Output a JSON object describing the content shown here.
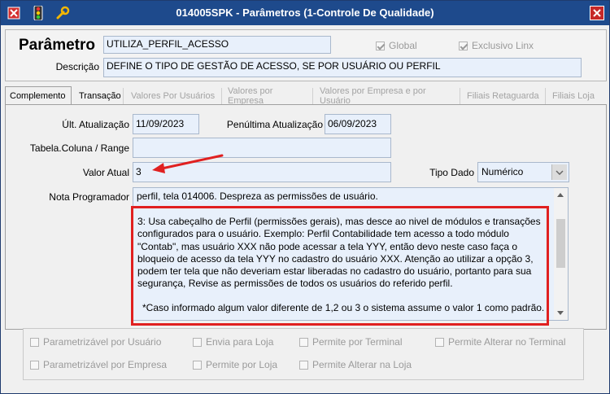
{
  "window": {
    "title": "014005SPK - Parâmetros (1-Controle De Qualidade)"
  },
  "header": {
    "parametro_label": "Parâmetro",
    "parametro_value": "UTILIZA_PERFIL_ACESSO",
    "descricao_label": "Descrição",
    "descricao_value": "DEFINE O TIPO DE GESTÃO DE ACESSO, SE POR USUÁRIO OU PERFIL",
    "global_label": "Global",
    "exclusivo_label": "Exclusivo Linx"
  },
  "tabs": [
    {
      "label": "Complemento"
    },
    {
      "label": "Transação"
    },
    {
      "label": "Valores Por Usuários"
    },
    {
      "label": "Valores por Empresa"
    },
    {
      "label": "Valores por Empresa e por Usuário"
    },
    {
      "label": "Filiais Retaguarda"
    },
    {
      "label": "Filiais Loja"
    }
  ],
  "form": {
    "ult_label": "Últ. Atualização",
    "ult_value": "11/09/2023",
    "pen_label": "Penúltima Atualização",
    "pen_value": "06/09/2023",
    "tabela_label": "Tabela.Coluna / Range",
    "tabela_value": "",
    "valor_label": "Valor Atual",
    "valor_value": "3",
    "tipo_label": "Tipo Dado",
    "tipo_value": "Numérico",
    "nota_label": "Nota Programador",
    "nota_line1": "perfil, tela 014006. Despreza as permissões de usuário.",
    "nota_body": "3: Usa cabeçalho de Perfil (permissões gerais), mas desce ao nivel de módulos e transações configurados para o usuário. Exemplo: Perfil Contabilidade tem acesso a todo módulo \"Contab\", mas usuário XXX não pode acessar a tela YYY, então devo neste caso faça o bloqueio de acesso da tela YYY no cadastro do usuário XXX. Atenção ao utilizar a opção 3, podem ter tela que não deveriam estar liberadas no cadastro do usuário, portanto para sua segurança, Revise as permissões de todos os usuários do referido perfil.",
    "nota_body2": "*Caso informado algum valor diferente de 1,2 ou 3 o sistema assume o valor 1 como padrão."
  },
  "checkboxes": {
    "param_usuario": "Parametrizável por Usuário",
    "envia_loja": "Envia para Loja",
    "permite_terminal": "Permite por Terminal",
    "permite_alterar_terminal": "Permite Alterar no Terminal",
    "param_empresa": "Parametrizável por Empresa",
    "permite_loja": "Permite por Loja",
    "permite_alterar_loja": "Permite Alterar na Loja"
  },
  "colors": {
    "titlebar": "#1e4a8c",
    "highlight": "#e02020",
    "field_bg": "#e8f0fb"
  }
}
